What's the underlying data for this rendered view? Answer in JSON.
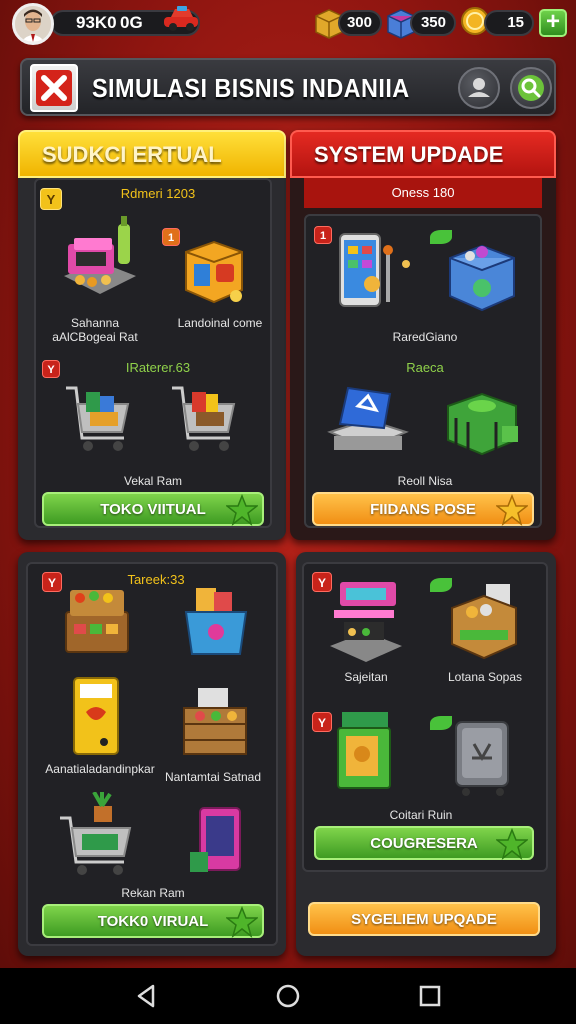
{
  "topbar": {
    "cash": "93K0",
    "cash_sub": "0G",
    "resource_gold": "300",
    "resource_gems": "350",
    "resource_coins": "15",
    "add_label": "+"
  },
  "header": {
    "title": "SIMULASI BISNIS INDANIIA"
  },
  "panels": {
    "top_left": {
      "ribbon": "SUDKCI ERTUAL",
      "subhead": "Rdmeri 1203",
      "badge": "Y",
      "item_badge": "1",
      "item1_label": "Sahanna aAlCBogeai Rat",
      "item2_label": "Landoinal come",
      "subhead2": "IRaterer.63",
      "subhead2_badge": "Y",
      "item3_label": "Vekal Ram",
      "button": "TOKO VIITUAL"
    },
    "top_right": {
      "ribbon": "SYSTEM UPDADE",
      "subhead": "Oness 180",
      "badge": "1",
      "item1_label": "RaredGiano",
      "subhead2": "Raeca",
      "item2_label": "Reoll Nisa",
      "button": "FIIDANS POSE"
    },
    "bottom_left": {
      "badge": "Y",
      "subhead": "Tareek:33",
      "item1_label": "Aanatialadandinpkar",
      "item2_label": "Nantamtai Satnad",
      "item3_label": "Rekan Ram",
      "button": "TOKK0 VIRUAL"
    },
    "bottom_right": {
      "badge": "Y",
      "badge2": "Y",
      "item1_label": "Sajeitan",
      "item2_label": "Lotana Sopas",
      "item3_label": "Coitari Ruin",
      "button": "COUGRESERA",
      "bottom_button": "SYGELIEM UPQADE"
    }
  },
  "colors": {
    "accent_yellow": "#f0b400",
    "accent_red": "#c8231a",
    "button_green": "#3e9b22",
    "button_orange": "#f18f14",
    "panel_bg": "#2b2b2f"
  }
}
